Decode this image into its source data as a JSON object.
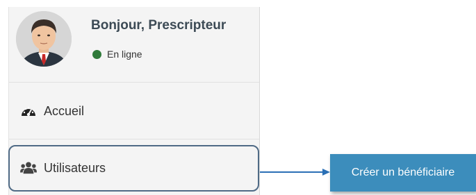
{
  "user_panel": {
    "greeting": "Bonjour, Prescripteur",
    "status_text": "En ligne"
  },
  "menu": {
    "items": [
      {
        "label": "Accueil",
        "icon": "dashboard-icon"
      },
      {
        "label": "Utilisateurs",
        "icon": "users-icon"
      }
    ]
  },
  "action": {
    "label": "Créer un bénéficiaire"
  },
  "colors": {
    "online": "#2f7a3a",
    "button": "#3c8dbc",
    "highlight": "#4f6a85",
    "arrow": "#2a6fb5"
  }
}
